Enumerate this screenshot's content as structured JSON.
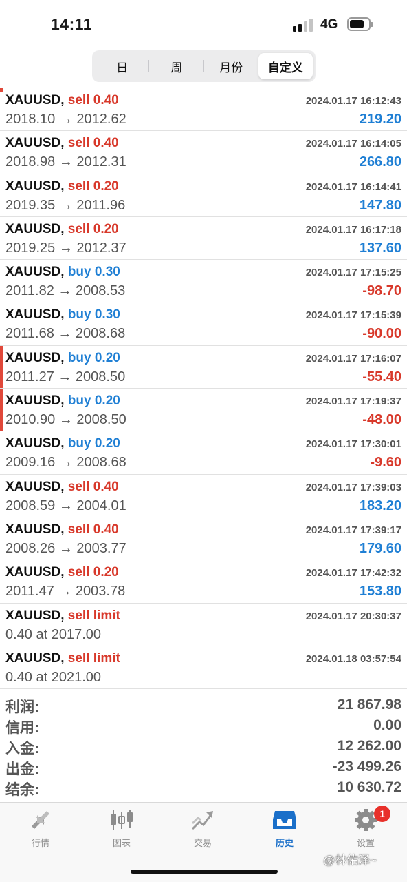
{
  "status_bar": {
    "time": "14:11",
    "network": "4G"
  },
  "segment": {
    "items": [
      {
        "label": "日"
      },
      {
        "label": "周"
      },
      {
        "label": "月份"
      },
      {
        "label": "自定义"
      }
    ],
    "active_index": 3
  },
  "trades": [
    {
      "symbol": "XAUUSD,",
      "side": "sell",
      "detail": "sell 0.40",
      "prices": "2018.10 → 2012.62",
      "time": "2024.01.17 16:12:43",
      "profit": "219.20"
    },
    {
      "symbol": "XAUUSD,",
      "side": "sell",
      "detail": "sell 0.40",
      "prices": "2018.98 → 2012.31",
      "time": "2024.01.17 16:14:05",
      "profit": "266.80"
    },
    {
      "symbol": "XAUUSD,",
      "side": "sell",
      "detail": "sell 0.20",
      "prices": "2019.35 → 2011.96",
      "time": "2024.01.17 16:14:41",
      "profit": "147.80"
    },
    {
      "symbol": "XAUUSD,",
      "side": "sell",
      "detail": "sell 0.20",
      "prices": "2019.25 → 2012.37",
      "time": "2024.01.17 16:17:18",
      "profit": "137.60"
    },
    {
      "symbol": "XAUUSD,",
      "side": "buy",
      "detail": "buy 0.30",
      "prices": "2011.82 → 2008.53",
      "time": "2024.01.17 17:15:25",
      "profit": "-98.70"
    },
    {
      "symbol": "XAUUSD,",
      "side": "buy",
      "detail": "buy 0.30",
      "prices": "2011.68 → 2008.68",
      "time": "2024.01.17 17:15:39",
      "profit": "-90.00"
    },
    {
      "symbol": "XAUUSD,",
      "side": "buy",
      "detail": "buy 0.20",
      "prices": "2011.27 → 2008.50",
      "time": "2024.01.17 17:16:07",
      "profit": "-55.40"
    },
    {
      "symbol": "XAUUSD,",
      "side": "buy",
      "detail": "buy 0.20",
      "prices": "2010.90 → 2008.50",
      "time": "2024.01.17 17:19:37",
      "profit": "-48.00"
    },
    {
      "symbol": "XAUUSD,",
      "side": "buy",
      "detail": "buy 0.20",
      "prices": "2009.16 → 2008.68",
      "time": "2024.01.17 17:30:01",
      "profit": "-9.60"
    },
    {
      "symbol": "XAUUSD,",
      "side": "sell",
      "detail": "sell 0.40",
      "prices": "2008.59 → 2004.01",
      "time": "2024.01.17 17:39:03",
      "profit": "183.20"
    },
    {
      "symbol": "XAUUSD,",
      "side": "sell",
      "detail": "sell 0.40",
      "prices": "2008.26 → 2003.77",
      "time": "2024.01.17 17:39:17",
      "profit": "179.60"
    },
    {
      "symbol": "XAUUSD,",
      "side": "sell",
      "detail": "sell 0.20",
      "prices": "2011.47 → 2003.78",
      "time": "2024.01.17 17:42:32",
      "profit": "153.80"
    },
    {
      "symbol": "XAUUSD,",
      "side": "sell",
      "detail": "sell limit",
      "prices": "0.40 at 2017.00",
      "time": "2024.01.17 20:30:37",
      "profit": ""
    },
    {
      "symbol": "XAUUSD,",
      "side": "sell",
      "detail": "sell limit",
      "prices": "0.40 at 2021.00",
      "time": "2024.01.18 03:57:54",
      "profit": ""
    }
  ],
  "summary": [
    {
      "label": "利润:",
      "value": "21 867.98"
    },
    {
      "label": "信用:",
      "value": "0.00"
    },
    {
      "label": "入金:",
      "value": "12 262.00"
    },
    {
      "label": "出金:",
      "value": "-23 499.26"
    },
    {
      "label": "结余:",
      "value": "10 630.72"
    }
  ],
  "tabbar": {
    "items": [
      {
        "label": "行情",
        "icon": "quotes-icon"
      },
      {
        "label": "图表",
        "icon": "chart-icon"
      },
      {
        "label": "交易",
        "icon": "trade-icon"
      },
      {
        "label": "历史",
        "icon": "history-icon"
      },
      {
        "label": "设置",
        "icon": "settings-icon"
      }
    ],
    "active_index": 3,
    "settings_badge": "1"
  },
  "watermark": "@林佑泽~",
  "colors": {
    "sell": "#d8392b",
    "buy": "#1f7fd4",
    "active_tab": "#1a6fc9",
    "marker": "#e0483a"
  }
}
